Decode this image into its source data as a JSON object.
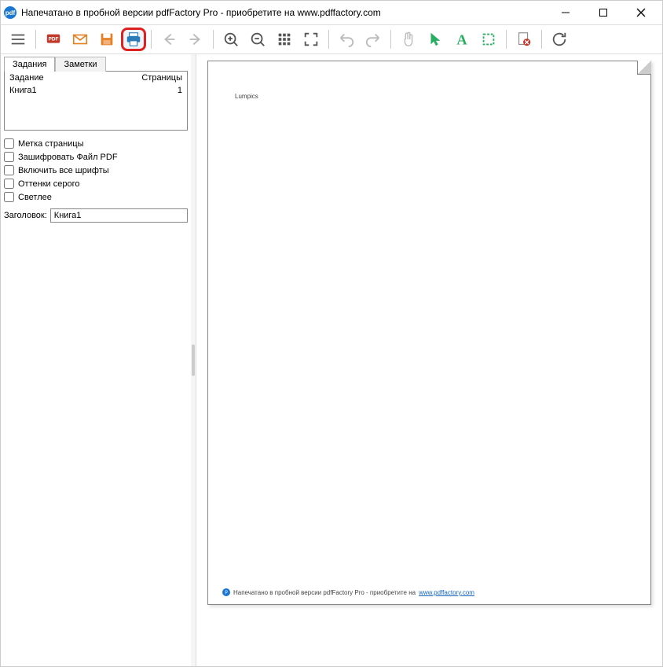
{
  "window": {
    "title": "Напечатано в пробной версии pdfFactory Pro - приобретите на www.pdffactory.com"
  },
  "sidebar": {
    "tabs": {
      "jobs": "Задания",
      "notes": "Заметки"
    },
    "job_table": {
      "col_job": "Задание",
      "col_pages": "Страницы",
      "rows": [
        {
          "name": "Книга1",
          "pages": "1"
        }
      ]
    },
    "checks": {
      "page_mark": "Метка страницы",
      "encrypt": "Зашифровать Файл PDF",
      "embed_fonts": "Включить все шрифты",
      "grayscale": "Оттенки серого",
      "lighter": "Светлее"
    },
    "title_label": "Заголовок:",
    "title_value": "Книга1"
  },
  "preview": {
    "page_content": "Lumpics",
    "watermark_text": "Напечатано в пробной версии pdfFactory Pro - приобретите на ",
    "watermark_link": "www.pdffactory.com"
  },
  "colors": {
    "orange": "#e67e22",
    "green": "#27ae60",
    "blue": "#2b7bb9",
    "gray": "#888"
  }
}
